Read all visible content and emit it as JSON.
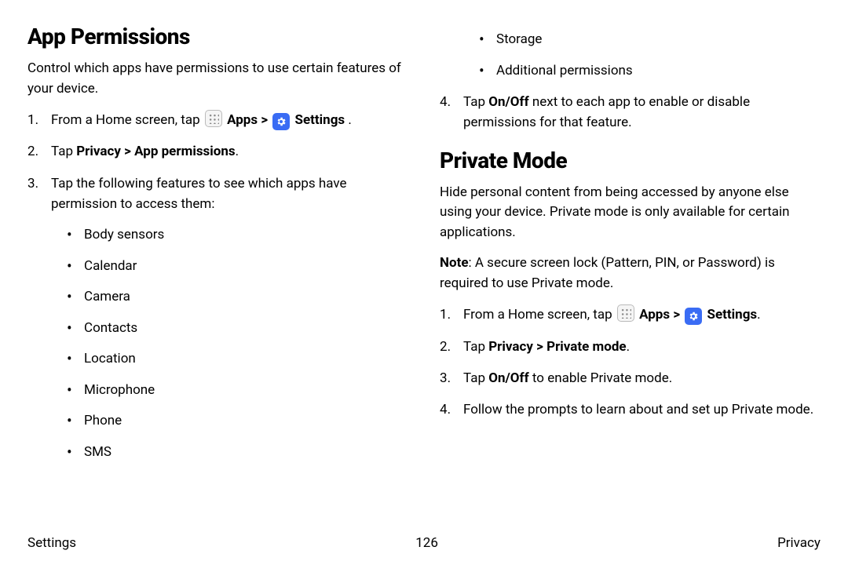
{
  "left": {
    "heading": "App Permissions",
    "intro": "Control which apps have permissions to use certain features of your device.",
    "step1_prefix": "From a Home screen, tap ",
    "apps_label": "Apps",
    "gt": " > ",
    "settings_label": "Settings",
    "period": " .",
    "step2_prefix": "Tap ",
    "step2_bold": "Privacy > App permissions",
    "step2_suffix": ".",
    "step3": "Tap the following features to see which apps have permission to access them:",
    "bullets": [
      "Body sensors",
      "Calendar",
      "Camera",
      "Contacts",
      "Location",
      "Microphone",
      "Phone",
      "SMS"
    ]
  },
  "right": {
    "top_bullets": [
      "Storage",
      "Additional permissions"
    ],
    "step4_prefix": "Tap ",
    "step4_bold": "On/Off",
    "step4_suffix": " next to each app to enable or disable permissions for that feature.",
    "heading": "Private Mode",
    "intro": "Hide personal content from being accessed by anyone else using your device. Private mode is only available for certain applications.",
    "note_label": "Note",
    "note_text": ": A secure screen lock (Pattern, PIN, or Password) is required to use Private mode.",
    "s1_prefix": "From a Home screen, tap ",
    "apps_label": "Apps",
    "gt": " > ",
    "settings_label": "Settings",
    "s1_suffix": ".",
    "s2_prefix": "Tap ",
    "s2_bold": "Privacy > Private mode",
    "s2_suffix": ".",
    "s3_prefix": "Tap ",
    "s3_bold": "On/Off",
    "s3_suffix": " to enable Private mode.",
    "s4": "Follow the prompts to learn about and set up Private mode."
  },
  "footer": {
    "left": "Settings",
    "center": "126",
    "right": "Privacy"
  }
}
